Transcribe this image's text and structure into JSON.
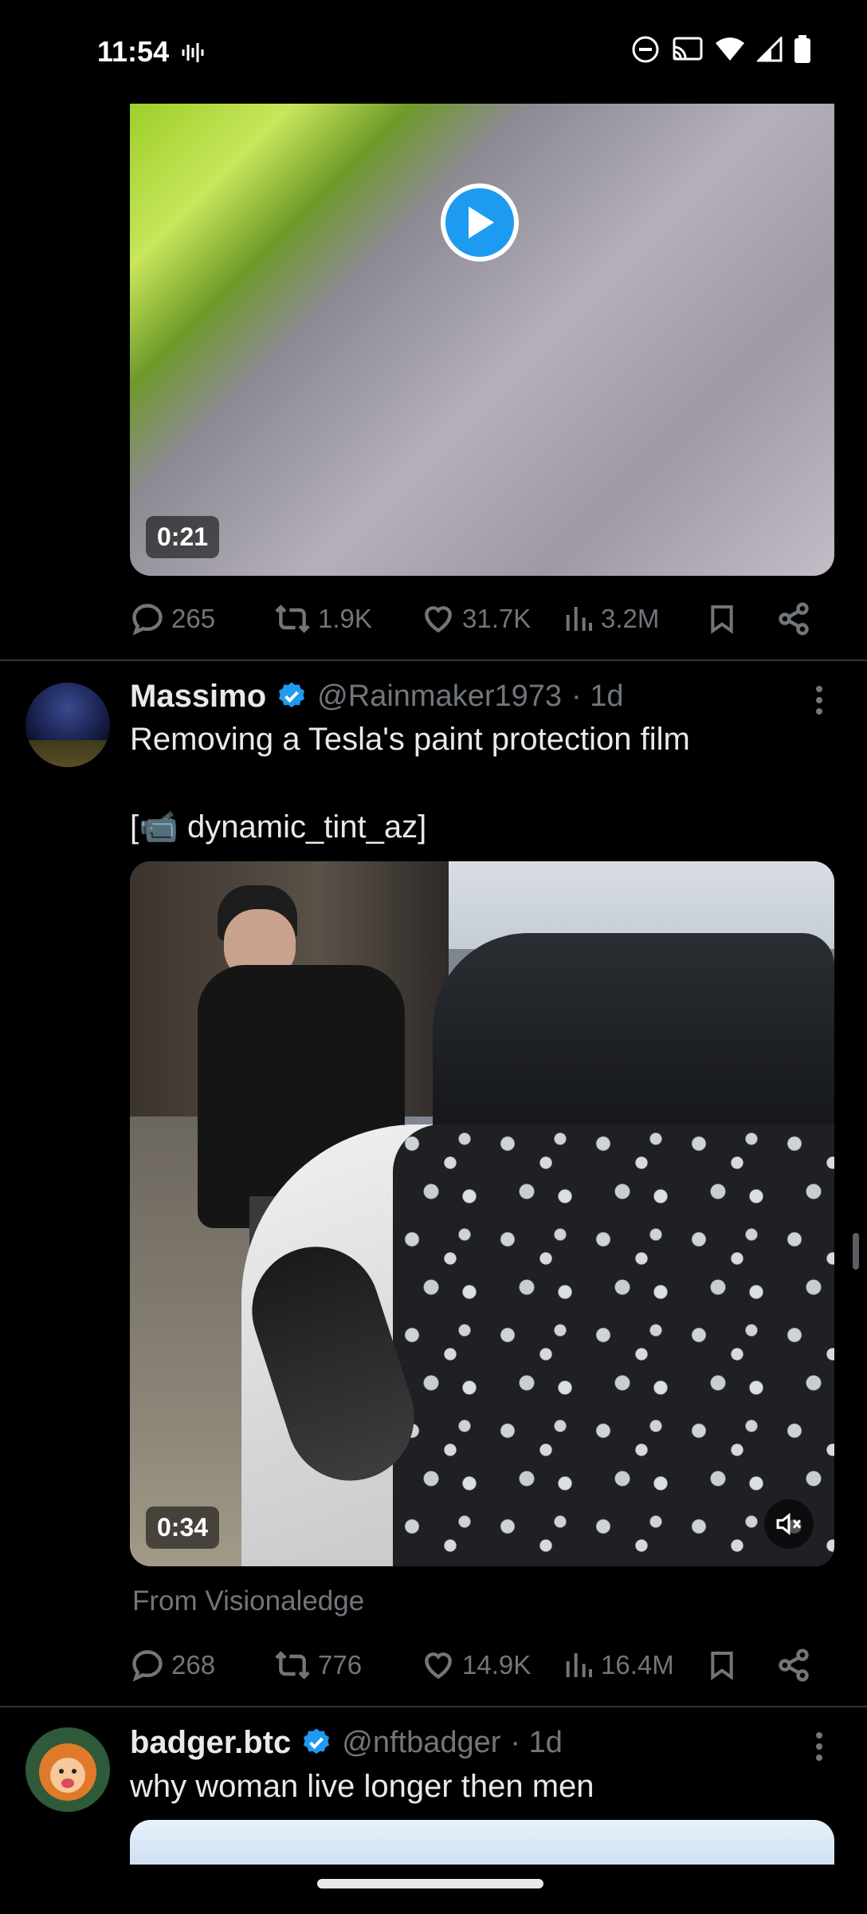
{
  "status_bar": {
    "time": "11:54"
  },
  "post1": {
    "video_duration": "0:21",
    "actions": {
      "replies": "265",
      "reposts": "1.9K",
      "likes": "31.7K",
      "views": "3.2M"
    }
  },
  "post2": {
    "name": "Massimo",
    "handle": "@Rainmaker1973",
    "time": "· 1d",
    "text": "Removing a Tesla's paint protection film",
    "credit": "[📹 dynamic_tint_az]",
    "video_duration": "0:34",
    "from": "From Visionaledge",
    "actions": {
      "replies": "268",
      "reposts": "776",
      "likes": "14.9K",
      "views": "16.4M"
    }
  },
  "post3": {
    "name": "badger.btc",
    "handle": "@nftbadger",
    "time": "· 1d",
    "text": "why woman live longer then men"
  },
  "colors": {
    "accent": "#1d9bf0",
    "muted": "#71767b",
    "text": "#e7e9ea",
    "divider": "#2f3336"
  }
}
